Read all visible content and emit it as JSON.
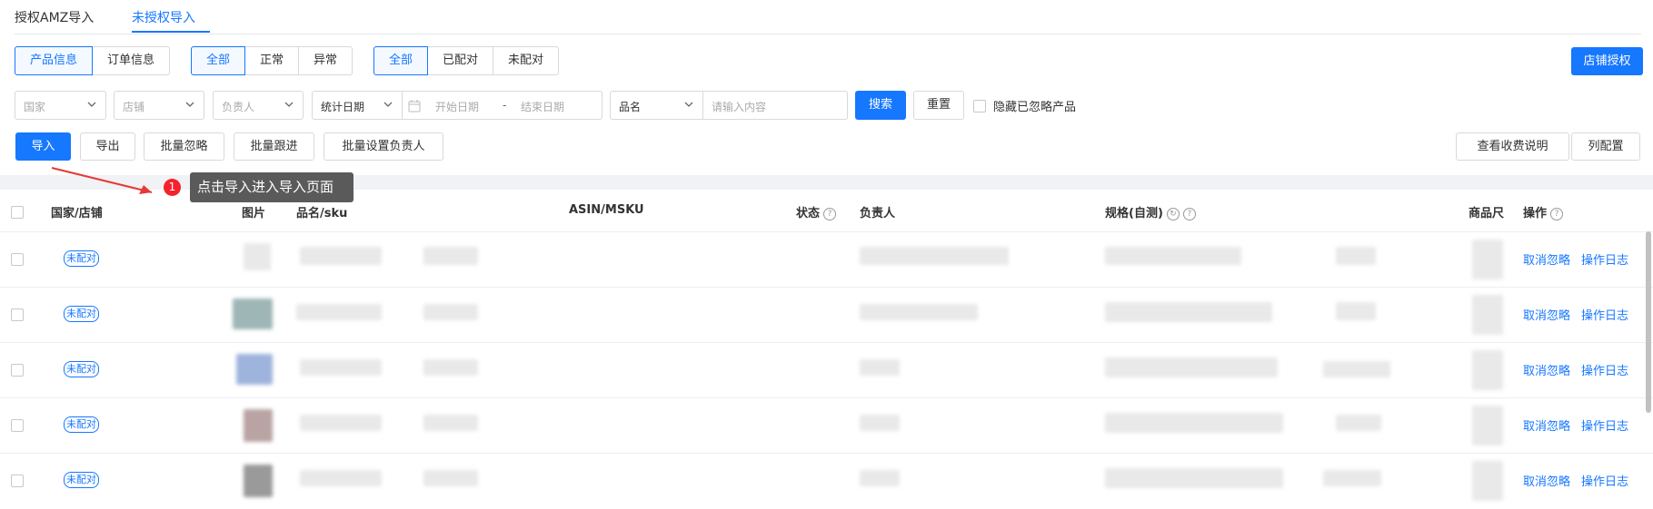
{
  "tabs": [
    {
      "label": "授权AMZ导入"
    },
    {
      "label": "未授权导入"
    }
  ],
  "filter_groups": {
    "info_type": [
      {
        "label": "产品信息"
      },
      {
        "label": "订单信息"
      }
    ],
    "status": [
      {
        "label": "全部"
      },
      {
        "label": "正常"
      },
      {
        "label": "异常"
      }
    ],
    "match": [
      {
        "label": "全部"
      },
      {
        "label": "已配对"
      },
      {
        "label": "未配对"
      }
    ]
  },
  "store_auth_label": "店铺授权",
  "filters": {
    "country_placeholder": "国家",
    "store_placeholder": "店铺",
    "owner_placeholder": "负责人",
    "date_type_value": "统计日期",
    "start_placeholder": "开始日期",
    "range_sep": "-",
    "end_placeholder": "结束日期",
    "field_value": "品名",
    "keyword_placeholder": "请输入内容",
    "search_label": "搜索",
    "reset_label": "重置",
    "hide_ignored_label": "隐藏已忽略产品"
  },
  "actions": {
    "import_label": "导入",
    "export_label": "导出",
    "batch_ignore_label": "批量忽略",
    "batch_follow_label": "批量跟进",
    "batch_owner_label": "批量设置负责人",
    "fee_info_label": "查看收费说明",
    "column_config_label": "列配置"
  },
  "tooltip": {
    "step": "1",
    "text": "点击导入进入导入页面"
  },
  "table": {
    "columns": {
      "country_store": "国家/店铺",
      "image": "图片",
      "name_sku": "品名/sku",
      "asin_msku": "ASIN/MSKU",
      "status": "状态",
      "owner": "负责人",
      "spec": "规格(自测)",
      "product_size": "商品尺",
      "ops": "操作"
    },
    "rows": [
      {
        "tag": "未配对",
        "op1": "取消忽略",
        "op2": "操作日志"
      },
      {
        "tag": "未配对",
        "op1": "取消忽略",
        "op2": "操作日志"
      },
      {
        "tag": "未配对",
        "op1": "取消忽略",
        "op2": "操作日志"
      },
      {
        "tag": "未配对",
        "op1": "取消忽略",
        "op2": "操作日志"
      },
      {
        "tag": "未配对",
        "op1": "取消忽略",
        "op2": "操作日志"
      }
    ]
  },
  "colors": {
    "accent": "#1677ff",
    "badge": "#f5222d",
    "arrow": "#e53935"
  }
}
